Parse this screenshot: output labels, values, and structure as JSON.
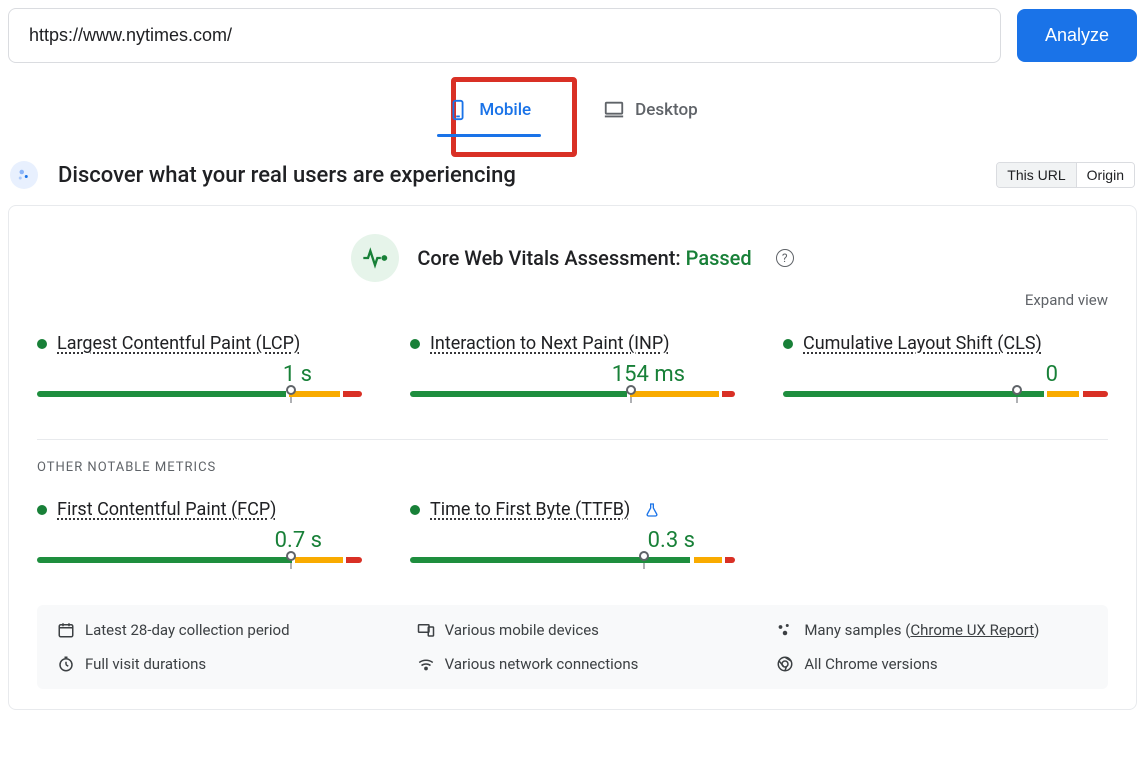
{
  "input": {
    "url": "https://www.nytimes.com/"
  },
  "analyze_button": "Analyze",
  "tabs": {
    "mobile": "Mobile",
    "desktop": "Desktop"
  },
  "section": {
    "title": "Discover what your real users are experiencing",
    "toggle": {
      "this_url": "This URL",
      "origin": "Origin"
    }
  },
  "cwv": {
    "label": "Core Web Vitals Assessment:",
    "status": "Passed",
    "expand": "Expand view"
  },
  "metrics": {
    "lcp": {
      "name": "Largest Contentful Paint (LCP)",
      "value": "1 s",
      "good_pct": 78,
      "ni_pct": 16,
      "poor_pct": 6,
      "marker_pct": 78
    },
    "inp": {
      "name": "Interaction to Next Paint (INP)",
      "value": "154 ms",
      "good_pct": 68,
      "ni_pct": 28,
      "poor_pct": 4,
      "marker_pct": 68
    },
    "cls": {
      "name": "Cumulative Layout Shift (CLS)",
      "value": "0",
      "good_pct": 82,
      "ni_pct": 10,
      "poor_pct": 8,
      "marker_pct": 72
    },
    "fcp": {
      "name": "First Contentful Paint (FCP)",
      "value": "0.7 s",
      "good_pct": 80,
      "ni_pct": 15,
      "poor_pct": 5,
      "marker_pct": 78
    },
    "ttfb": {
      "name": "Time to First Byte (TTFB)",
      "value": "0.3 s",
      "good_pct": 88,
      "ni_pct": 9,
      "poor_pct": 3,
      "marker_pct": 72
    }
  },
  "other_label": "OTHER NOTABLE METRICS",
  "footer": {
    "period": "Latest 28-day collection period",
    "devices": "Various mobile devices",
    "samples_prefix": "Many samples (",
    "samples_link": "Chrome UX Report",
    "samples_suffix": ")",
    "durations": "Full visit durations",
    "network": "Various network connections",
    "versions": "All Chrome versions"
  }
}
